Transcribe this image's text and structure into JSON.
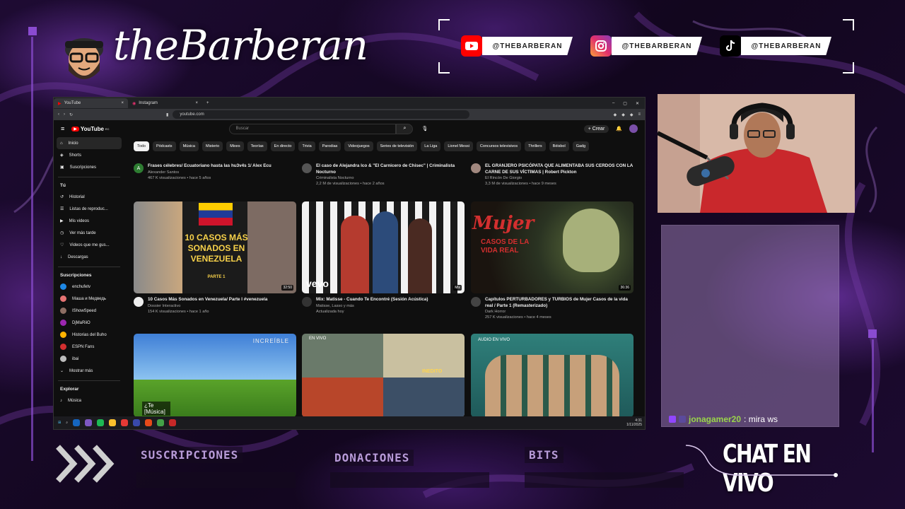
{
  "header": {
    "brand_name": "theBarberan",
    "socials": [
      {
        "icon": "youtube-icon",
        "handle": "@THEBARBERAN",
        "color": "#ff0000"
      },
      {
        "icon": "instagram-icon",
        "handle": "@THEBARBERAN",
        "color": "#e1306c"
      },
      {
        "icon": "tiktok-icon",
        "handle": "@THEBARBERAN",
        "color": "#000000"
      }
    ]
  },
  "browser": {
    "tabs": [
      {
        "label": "YouTube"
      },
      {
        "label": "Instagram"
      }
    ],
    "url": "youtube.com",
    "youtube": {
      "logo": "YouTube",
      "logo_suffix": "EC",
      "search_placeholder": "Buscar",
      "create_label": "+ Crear",
      "sidebar": {
        "main": [
          "Inicio",
          "Shorts",
          "Suscripciones"
        ],
        "you_head": "Tú",
        "you": [
          "Historial",
          "Listas de reproduc...",
          "Mis videos",
          "Ver más tarde",
          "Videos que me gus...",
          "Descargas"
        ],
        "subs_head": "Suscripciones",
        "subs": [
          "enchufetv",
          "Маша и Медведь",
          "IShowSpeed",
          "DjMaRiiO",
          "Historias del Buho",
          "ESPN Fans",
          "ibai"
        ],
        "show_more": "Mostrar más",
        "explore_head": "Explorar",
        "explore": [
          "Música"
        ]
      },
      "chips": [
        "Todo",
        "Pódcasts",
        "Música",
        "Misterio",
        "Mixes",
        "Teorías",
        "En directo",
        "Trivia",
        "Parodias",
        "Videojuegos",
        "Series de televisión",
        "La Liga",
        "Lionel Messi",
        "Concursos televisivos",
        "Thrillers",
        "Béisbol",
        "Gadg"
      ],
      "row1": [
        {
          "title": "Frases célebres/ Ecuatoriano hasta las hu3v4s 1/ Alex Ecu",
          "channel": "Alexander Santos",
          "stats": "467 K visualizaciones • hace 5 años",
          "avatar": "A"
        },
        {
          "title": "El caso de Alejandra Ico & \"El Carnicero de Chisec\" | Criminalista Nocturno",
          "channel": "Criminalista Nocturno",
          "stats": "2,2 M de visualizaciones • hace 2 años"
        },
        {
          "title": "EL GRANJERO PSICÓPATA QUE ALIMENTABA SUS CERDOS CON LA CARNE DE SUS VÍCTIMAS | Robert Pickton",
          "channel": "El Rincón De Giorgio",
          "stats": "3,3 M de visualizaciones • hace 9 meses"
        }
      ],
      "row2": [
        {
          "title": "10 Casos Más Sonados en Venezuela/ Parte I #venezuela",
          "channel": "Dossier Interactivo",
          "stats": "154 K visualizaciones • hace 1 año",
          "duration": "32:50",
          "thumb_text": "10 CASOS MÁS SONADOS EN VENEZUELA",
          "thumb_sub": "PARTE 1"
        },
        {
          "title": "Mix: Matisse - Cuando Te Encontré (Sesión Acústica)",
          "channel": "Matisse, Lasso y más",
          "stats": "Actualizada hoy",
          "duration": "Mix",
          "thumb_text": "vevo"
        },
        {
          "title": "Capítulos PERTURBADORES y TURBIOS de Mujer Casos de la vida real / Parte 1 (Remasterizado)",
          "channel": "Dark Horror",
          "stats": "257 K visualizaciones • hace 4 meses",
          "duration": "36:36",
          "thumb_text": "Mujer",
          "thumb_sub": "CASOS DE LA VIDA REAL"
        }
      ],
      "row3": [
        {
          "thumb_text": "INCREÍBLE",
          "overlay": "¿Te [Música]"
        },
        {
          "thumb_text": "EN VIVO",
          "thumb_sub": "INEDITO"
        },
        {
          "thumb_text": "AUDIO EN VIVO"
        }
      ]
    },
    "taskbar": {
      "time": "4:31",
      "date": "1/11/2025"
    }
  },
  "chat": {
    "message_user": "jonagamer20",
    "message_text": ": mira ws",
    "title": "CHAT EN VIVO"
  },
  "footer": {
    "labels": [
      "SUSCRIPCIONES",
      "DONACIONES",
      "BITS"
    ]
  }
}
